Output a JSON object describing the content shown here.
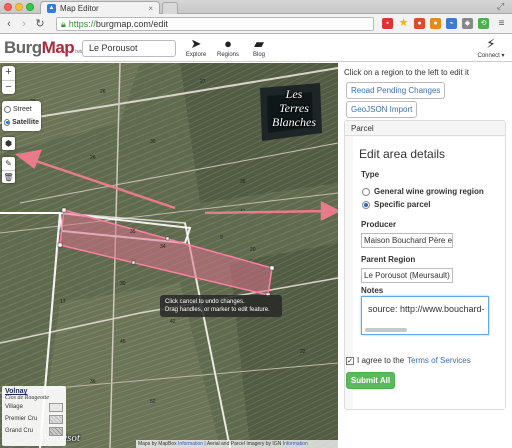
{
  "browser": {
    "tab_title": "Map Editor",
    "url_scheme": "https://",
    "url_rest": "burgmap.com/edit"
  },
  "header": {
    "logo_part1": "Burg",
    "logo_part2": "Map",
    "logo_beta": "beta",
    "place_name": "Le Porousot",
    "nav": [
      {
        "label": "Explore",
        "icon": "compass-arrow-icon"
      },
      {
        "label": "Regions",
        "icon": "globe-icon"
      },
      {
        "label": "Blog",
        "icon": "book-icon"
      },
      {
        "label": "Connect",
        "icon": "lightning-icon"
      }
    ]
  },
  "map": {
    "zoom_in": "+",
    "zoom_out": "−",
    "layers": {
      "street": "Street",
      "satellite": "Satellite",
      "selected": "satellite"
    },
    "region_label_1": "Les",
    "region_label_2": "Terres",
    "region_label_3": "Blanches",
    "region_label_bottom": "Porousot",
    "tooltip_line1": "Click cancel to undo changes.",
    "tooltip_line2": "Drag handles, or marker to edit feature.",
    "legend": {
      "title": "Volnay",
      "subtitle": "Clos de Rougeotte",
      "rows": [
        {
          "label": "Village",
          "color": "#e8e8e8"
        },
        {
          "label": "Premier Cru",
          "color": "#d8d8d8"
        },
        {
          "label": "Grand Cru",
          "color": "#c8c8c8"
        }
      ]
    },
    "attribution_prefix": "Maps by MapBox",
    "attribution_link1": "Information",
    "attribution_mid": " | Aerial and Parcel Imagery by IGN",
    "attribution_link2": "Information"
  },
  "sidebar": {
    "hint": "Click on a region to the left to edit it",
    "reload_button": "Reoad Pending Changes",
    "geojson_button": "GeoJSON Import",
    "panel_title": "Parcel",
    "edit_heading": "Edit area details",
    "type_label": "Type",
    "type_options": [
      "General wine growing region",
      "Specific parcel"
    ],
    "type_selected": "Specific parcel",
    "producer_label": "Producer",
    "producer_value": "Maison Bouchard Père et",
    "parent_label": "Parent Region",
    "parent_value": "Le Porousot (Meursault)",
    "notes_label": "Notes",
    "notes_value": "source:  http://www.bouchard-",
    "agree_prefix": "I agree to the",
    "agree_link": "Terms of Services",
    "agree_checked": true,
    "submit_label": "Submit All",
    "accent_color": "#5cb85c"
  }
}
